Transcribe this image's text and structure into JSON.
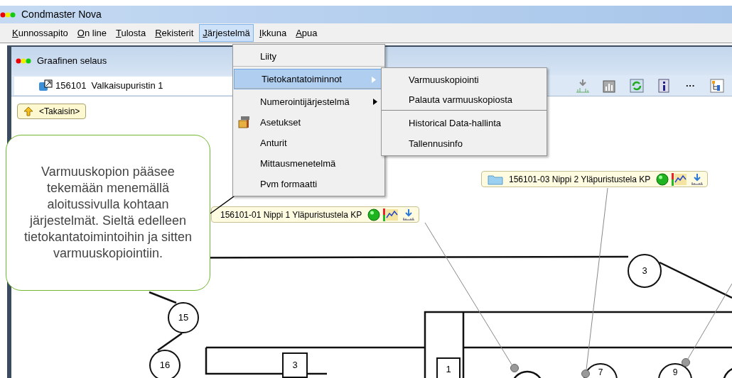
{
  "window": {
    "title": "Condmaster Nova"
  },
  "menu_bar": [
    {
      "label": "Kunnossapito",
      "selected": false
    },
    {
      "label": "On line",
      "selected": false
    },
    {
      "label": "Tulosta",
      "selected": false
    },
    {
      "label": "Rekisterit",
      "selected": false
    },
    {
      "label": "Järjestelmä",
      "selected": true
    },
    {
      "label": "Ikkuna",
      "selected": false
    },
    {
      "label": "Apua",
      "selected": false
    }
  ],
  "dropdown": [
    {
      "label": "Liity",
      "kind": "plain",
      "has_submenu": false,
      "selected": false,
      "separator_after": true
    },
    {
      "label": "Tietokantatoiminnot",
      "kind": "plain",
      "has_submenu": true,
      "selected": true,
      "separator_after": true
    },
    {
      "label": "Numerointijärjestelmä",
      "kind": "plain",
      "has_submenu": true,
      "selected": false,
      "separator_after": false
    },
    {
      "label": "Asetukset",
      "kind": "with_icon",
      "has_submenu": false,
      "selected": false,
      "separator_after": false
    },
    {
      "label": "Anturit",
      "kind": "plain",
      "has_submenu": false,
      "selected": false,
      "separator_after": false
    },
    {
      "label": "Mittausmenetelmä",
      "kind": "plain",
      "has_submenu": false,
      "selected": false,
      "separator_after": false
    },
    {
      "label": "Pvm formaatti",
      "kind": "plain",
      "has_submenu": false,
      "selected": false,
      "separator_after": false
    }
  ],
  "submenu": [
    {
      "label": "Varmuuskopiointi",
      "separator_after": false
    },
    {
      "label": "Palauta varmuuskopiosta",
      "separator_after": true
    },
    {
      "label": "Historical Data-hallinta",
      "separator_after": false
    },
    {
      "label": "Tallennusinfo",
      "separator_after": false
    }
  ],
  "inner_window": {
    "title": "Graafinen selaus",
    "location": "156101  Valkaisupuristin 1",
    "back_button": "<Takaisin>",
    "toolbar_more": "···"
  },
  "callout": {
    "text": "Varmuuskopion pääsee tekemään menemällä aloitussivulla kohtaan järjestelmät. Sieltä edelleen tietokantatoimintoihin ja sitten varmuuskopiointiin."
  },
  "diagram": {
    "labels": [
      {
        "text": "3",
        "kind": "circle"
      },
      {
        "text": "15",
        "kind": "circle"
      },
      {
        "text": "16",
        "kind": "circle"
      },
      {
        "text": "3",
        "kind": "square"
      },
      {
        "text": "1",
        "kind": "square"
      },
      {
        "text": "7",
        "kind": "circle"
      },
      {
        "text": "9",
        "kind": "circle"
      }
    ],
    "tags": [
      {
        "text": "156101-01  Nippi 1 Yläpuristustela KP",
        "kind": "plain"
      },
      {
        "text": "156101-03  Nippi 2 Yläpuristustela KP",
        "kind": "folder"
      }
    ]
  }
}
